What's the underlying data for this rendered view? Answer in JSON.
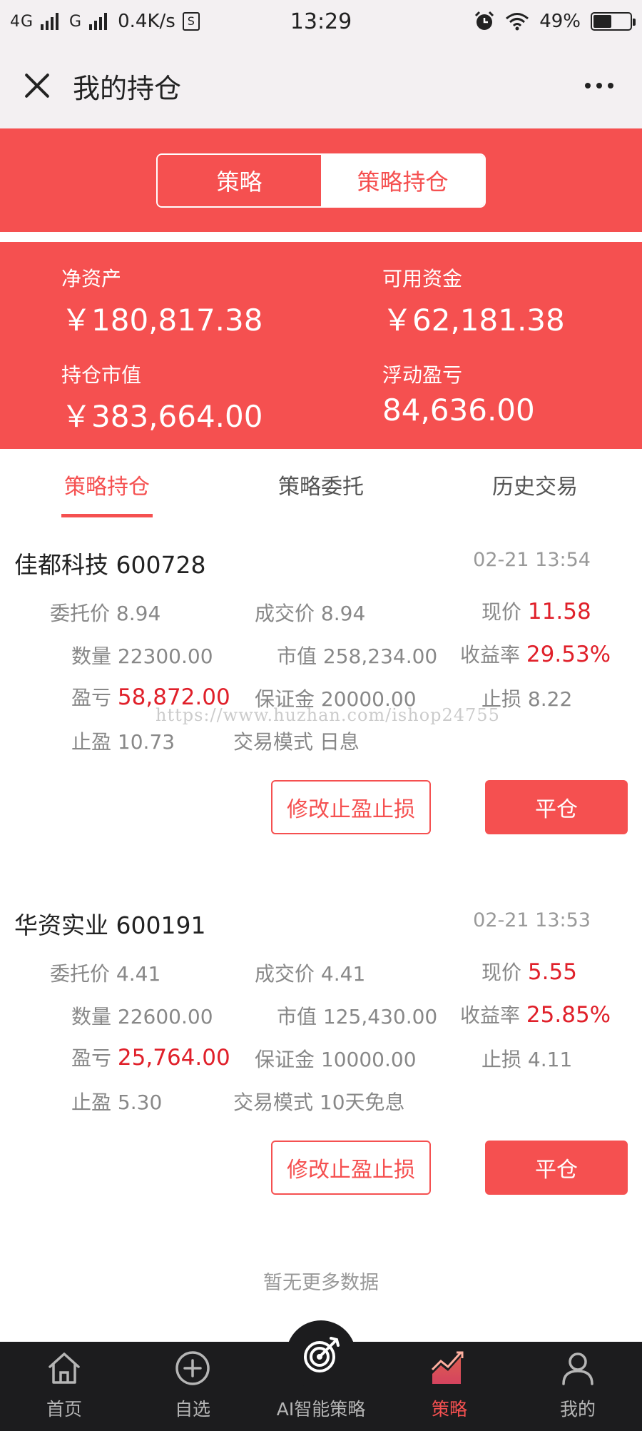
{
  "status_bar": {
    "network1": "4G",
    "network2": "G",
    "speed": "0.4K/s",
    "speed_icon": "S",
    "time": "13:29",
    "battery": "49%",
    "battery_level": 0.49
  },
  "nav": {
    "title": "我的持仓"
  },
  "segment": {
    "left_label": "策略",
    "right_label": "策略持仓"
  },
  "assets": {
    "net_label": "净资产",
    "net_value": "￥180,817.38",
    "available_label": "可用资金",
    "available_value": "￥62,181.38",
    "market_label": "持仓市值",
    "market_value": "￥383,664.00",
    "float_label": "浮动盈亏",
    "float_value": "84,636.00"
  },
  "tabs": [
    "策略持仓",
    "策略委托",
    "历史交易"
  ],
  "positions": [
    {
      "name": "佳都科技 600728",
      "time": "02-21 13:54",
      "order_price_label": "委托价",
      "order_price": "8.94",
      "deal_price_label": "成交价",
      "deal_price": "8.94",
      "current_label": "现价",
      "current": "11.58",
      "qty_label": "数量",
      "qty": "22300.00",
      "mv_label": "市值",
      "mv": "258,234.00",
      "yield_label": "收益率",
      "yield": "29.53%",
      "pnl_label": "盈亏",
      "pnl": "58,872.00",
      "margin_label": "保证金",
      "margin": "20000.00",
      "stoploss_label": "止损",
      "stoploss": "8.22",
      "takeprofit_label": "止盈",
      "takeprofit": "10.73",
      "mode_label": "交易模式",
      "mode": "日息",
      "edit_button": "修改止盈止损",
      "close_button": "平仓"
    },
    {
      "name": "华资实业 600191",
      "time": "02-21 13:53",
      "order_price_label": "委托价",
      "order_price": "4.41",
      "deal_price_label": "成交价",
      "deal_price": "4.41",
      "current_label": "现价",
      "current": "5.55",
      "qty_label": "数量",
      "qty": "22600.00",
      "mv_label": "市值",
      "mv": "125,430.00",
      "yield_label": "收益率",
      "yield": "25.85%",
      "pnl_label": "盈亏",
      "pnl": "25,764.00",
      "margin_label": "保证金",
      "margin": "10000.00",
      "stoploss_label": "止损",
      "stoploss": "4.11",
      "takeprofit_label": "止盈",
      "takeprofit": "5.30",
      "mode_label": "交易模式",
      "mode": "10天免息",
      "edit_button": "修改止盈止损",
      "close_button": "平仓"
    }
  ],
  "no_more": "暂无更多数据",
  "watermark": "https://www.huzhan.com/ishop24755",
  "tabbar": [
    {
      "label": "首页",
      "icon": "home-icon"
    },
    {
      "label": "自选",
      "icon": "plus-circle-icon"
    },
    {
      "label": "AI智能策略",
      "icon": "target-icon"
    },
    {
      "label": "策略",
      "icon": "chart-trend-icon"
    },
    {
      "label": "我的",
      "icon": "user-icon"
    }
  ],
  "colors": {
    "accent": "#f55050",
    "loss_red": "#e0202a",
    "tabbar_bg": "#1c1c1e"
  }
}
